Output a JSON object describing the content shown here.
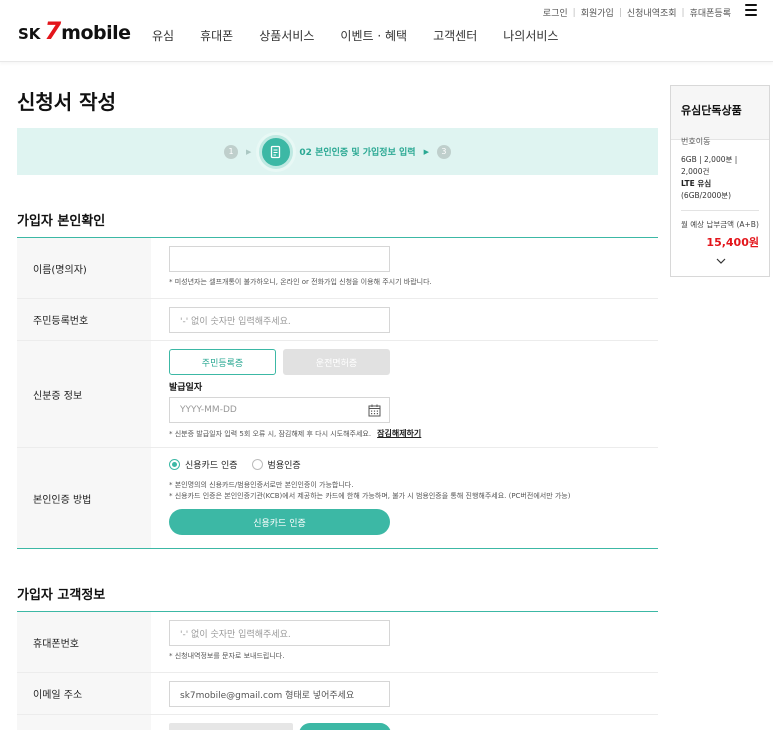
{
  "header": {
    "util_links": [
      "로그인",
      "회원가입",
      "신청내역조회",
      "휴대폰등록"
    ],
    "logo": {
      "sk": "SK",
      "seven": "7",
      "mobile": "mobile"
    },
    "nav": [
      "유심",
      "휴대폰",
      "상품서비스",
      "이벤트 · 혜택",
      "고객센터",
      "나의서비스"
    ]
  },
  "page_title": "신청서 작성",
  "steps": {
    "step1": "1",
    "active_label": "02 본인인증 및 가입정보 입력",
    "step3": "3"
  },
  "section1": {
    "title": "가입자 본인확인",
    "name_label": "이름(명의자)",
    "name_value": "",
    "name_note": "* 미성년자는 셀프개통이 불가하오니, 온라인 or 전화가입 신청을 이용해 주시기 바랍니다.",
    "rrn_label": "주민등록번호",
    "rrn_placeholder": "'-' 없이 숫자만 입력해주세요.",
    "id_label": "신분증 정보",
    "id_tab_on": "주민등록증",
    "id_tab_off": "운전면허증",
    "issue_date_label": "발급일자",
    "issue_date_placeholder": "YYYY-MM-DD",
    "issue_note": "* 신분증 발급일자 입력 5회 오류 시, 잠김해제 후 다시 시도해주세요.",
    "unlock_link": "잠김해제하기",
    "auth_label": "본인인증 방법",
    "radio_card": "신용카드 인증",
    "radio_cert": "범용인증",
    "auth_note1": "* 본인명의의 신용카드/범용인증서로만 본인인증이 가능합니다.",
    "auth_note2": "* 신용카드 인증은 본인인증기관(KCB)에서 제공하는 카드에 한해 가능하며, 불가 시 범용인증을 통해 진행해주세요. (PC버전에서만 가능)",
    "auth_button": "신용카드 인증"
  },
  "section2": {
    "title": "가입자 고객정보",
    "phone_label": "휴대폰번호",
    "phone_placeholder": "'-' 없이 숫자만 입력해주세요.",
    "phone_note": "* 신청내역정보를 문자로 보내드립니다.",
    "email_label": "이메일 주소",
    "email_placeholder": "sk7mobile@gmail.com 형태로 넣어주세요"
  },
  "side": {
    "title": "유심단독상품",
    "sub": "번호이동",
    "spec_line1": "6GB | 2,000분 | 2,000건",
    "spec_line2": "LTE 유심",
    "spec_line3": "(6GB/2000분)",
    "price_label": "월 예상 납부금액 (A+B)",
    "price": "15,400원"
  },
  "colors": {
    "accent": "#3cb8a5",
    "brand_red": "#e3151b",
    "step_bg": "#dff4f1"
  }
}
